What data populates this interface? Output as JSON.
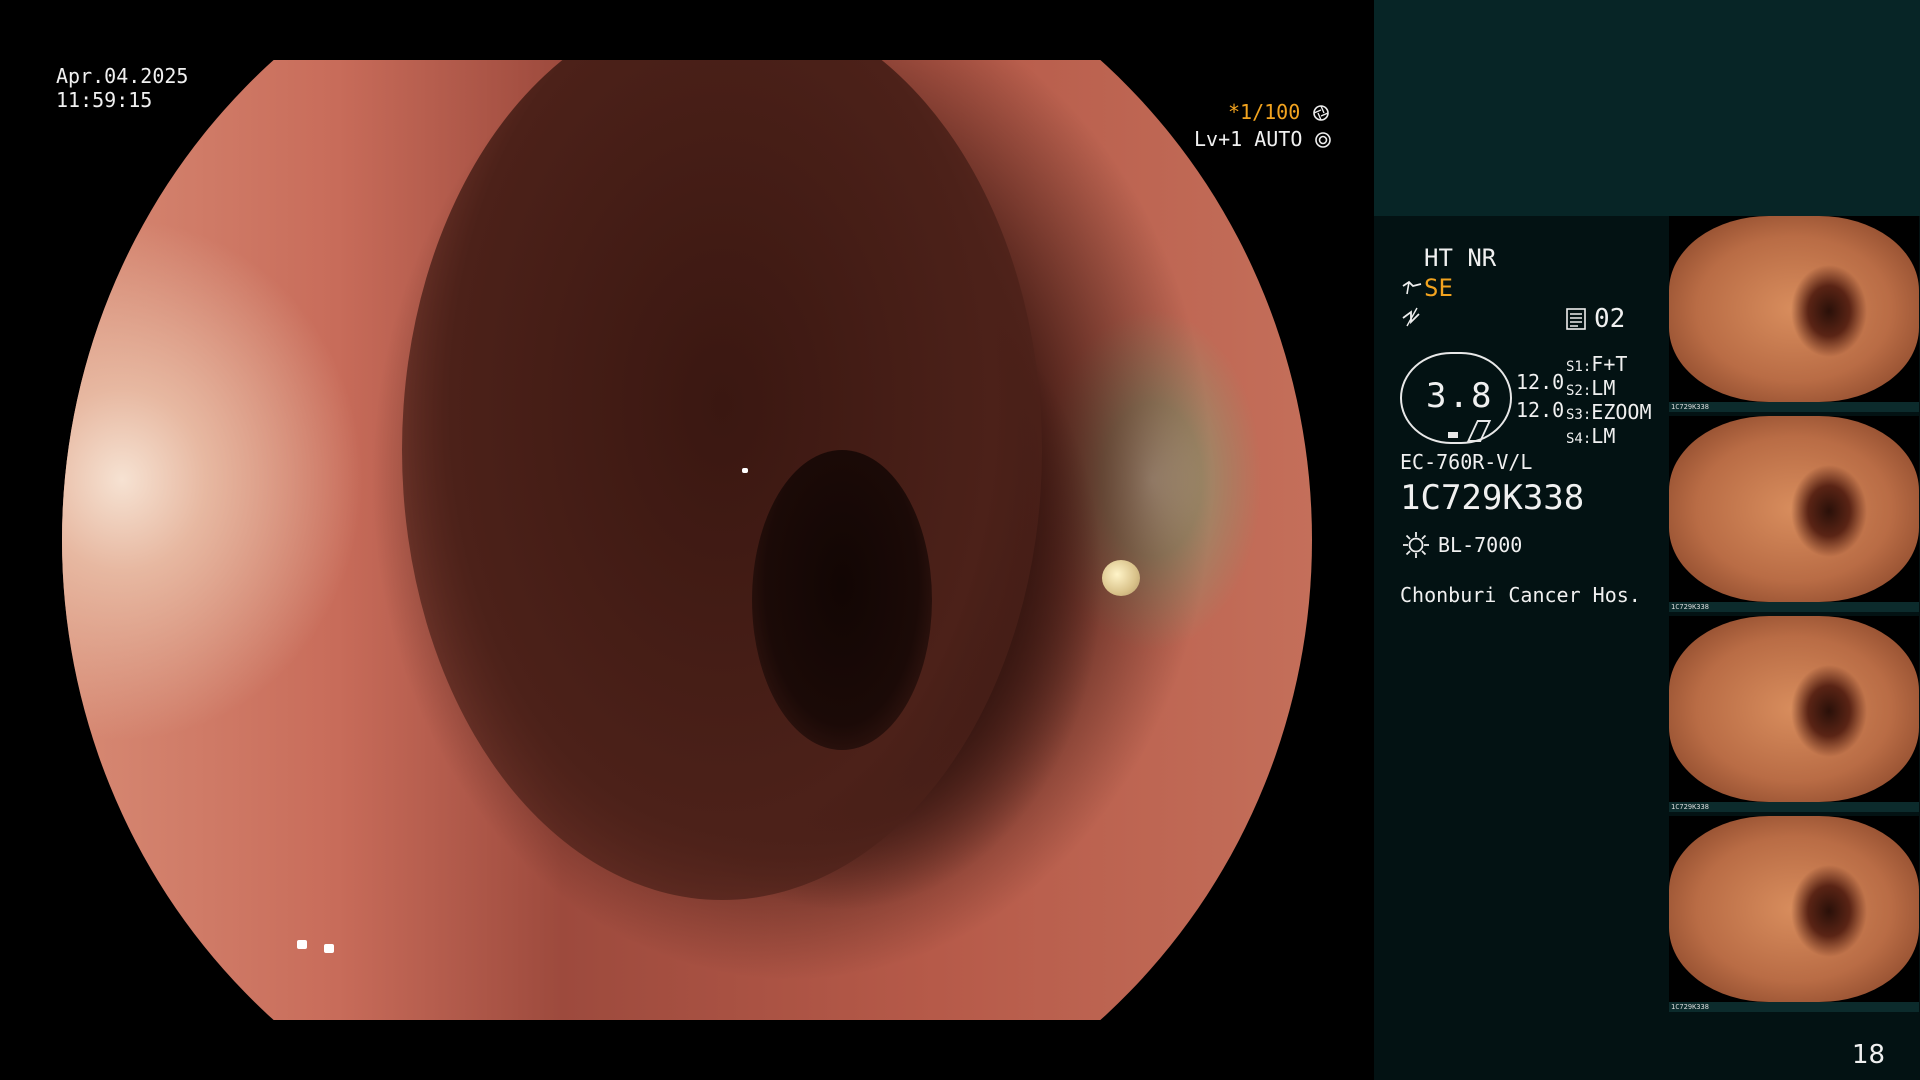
{
  "overlay": {
    "date": "Apr.04.2025",
    "time": "11:59:15",
    "shutter": "*1/100",
    "level": "Lv+1 AUTO"
  },
  "panel": {
    "ht_nr": "HT NR",
    "se": "SE",
    "preset_num": "02",
    "speed": "3.8",
    "val1": "12.0",
    "val2": "12.0",
    "s1_label": "S1:",
    "s1_val": "F+T",
    "s2_label": "S2:",
    "s2_val": "LM",
    "s3_label": "S3:",
    "s3_val": "EZOOM",
    "s4_label": "S4:",
    "s4_val": "LM",
    "scope_model": "EC-760R-V/L",
    "serial": "1C729K338",
    "light_source": "BL-7000",
    "hospital": "Chonburi Cancer Hos.",
    "page_number": "18"
  },
  "thumbnails": [
    {
      "caption": "1C729K338"
    },
    {
      "caption": "1C729K338"
    },
    {
      "caption": "1C729K338"
    },
    {
      "caption": "1C729K338"
    }
  ],
  "icons": {
    "aperture": "aperture-icon",
    "auto_ring": "auto-ring-icon",
    "scope": "scope-icon",
    "wave": "wave-icon",
    "preset": "preset-icon",
    "sun": "sun-icon"
  }
}
